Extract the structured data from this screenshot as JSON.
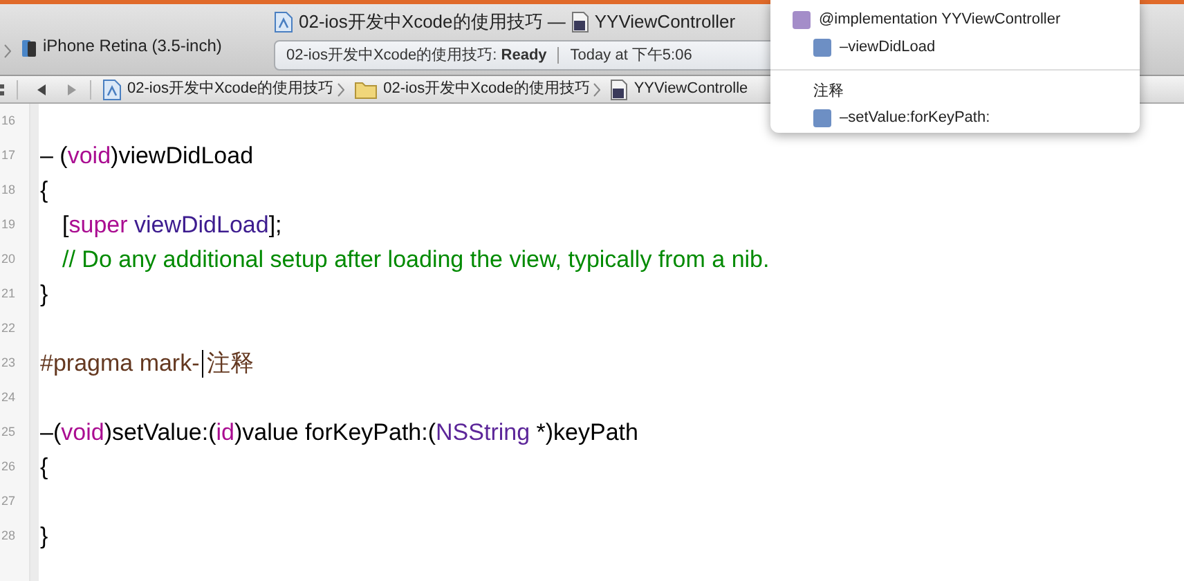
{
  "toolbar": {
    "device": "iPhone Retina (3.5-inch)",
    "title": "02-ios开发中Xcode的使用技巧 — ",
    "title_file": "YYViewController",
    "status": "02-ios开发中Xcode的使用技巧: **Ready**",
    "status_time": "Today at 下午5:06"
  },
  "jump_bar": {
    "crumbs": [
      {
        "kind": "project",
        "label": "02-ios开发中Xcode的使用技巧"
      },
      {
        "kind": "folder",
        "label": "02-ios开发中Xcode的使用技巧"
      },
      {
        "kind": "file",
        "label": "YYViewControlle"
      }
    ]
  },
  "editor": {
    "lines": [
      {
        "number": "16"
      },
      {
        "number": "17",
        "tokens": [
          {
            "kind": "plain",
            "text": "– ("
          },
          {
            "kind": "keyword",
            "text": "void"
          },
          {
            "kind": "plain",
            "text": ")viewDidLoad"
          }
        ]
      },
      {
        "number": "18",
        "tokens": [
          {
            "kind": "plain",
            "text": "{"
          }
        ]
      },
      {
        "number": "19",
        "tokens": [
          {
            "kind": "indent"
          },
          {
            "kind": "plain",
            "text": "["
          },
          {
            "kind": "keyword",
            "text": "super"
          },
          {
            "kind": "method",
            "text": " viewDidLoad"
          },
          {
            "kind": "plain",
            "text": "];"
          }
        ]
      },
      {
        "number": "20",
        "tokens": [
          {
            "kind": "indent"
          },
          {
            "kind": "comment",
            "text": "// Do any additional setup after loading the view, typically from a nib."
          }
        ]
      },
      {
        "number": "21",
        "tokens": [
          {
            "kind": "plain",
            "text": "}"
          }
        ]
      },
      {
        "number": "22"
      },
      {
        "number": "23",
        "tokens": [
          {
            "kind": "pragma",
            "text": "#pragma mark-"
          },
          {
            "kind": "caret"
          },
          {
            "kind": "pragma",
            "text": "注释"
          }
        ]
      },
      {
        "number": "24"
      },
      {
        "number": "25",
        "tokens": [
          {
            "kind": "plain",
            "text": "–("
          },
          {
            "kind": "keyword",
            "text": "void"
          },
          {
            "kind": "plain",
            "text": ")setValue:("
          },
          {
            "kind": "keyword",
            "text": "id"
          },
          {
            "kind": "plain",
            "text": ")value forKeyPath:("
          },
          {
            "kind": "type",
            "text": "NSString"
          },
          {
            "kind": "plain",
            "text": " *)keyPath"
          }
        ]
      },
      {
        "number": "26",
        "tokens": [
          {
            "kind": "plain",
            "text": "{"
          }
        ]
      },
      {
        "number": "27"
      },
      {
        "number": "28",
        "tokens": [
          {
            "kind": "plain",
            "text": "}"
          }
        ]
      }
    ]
  },
  "symbol_menu": {
    "items": [
      {
        "kind": "class",
        "label": "@implementation YYViewController"
      },
      {
        "kind": "method",
        "label": "–viewDidLoad"
      },
      {
        "kind": "separator"
      },
      {
        "kind": "header",
        "label": "注释"
      },
      {
        "kind": "method",
        "label": "–setValue:forKeyPath:"
      }
    ]
  }
}
